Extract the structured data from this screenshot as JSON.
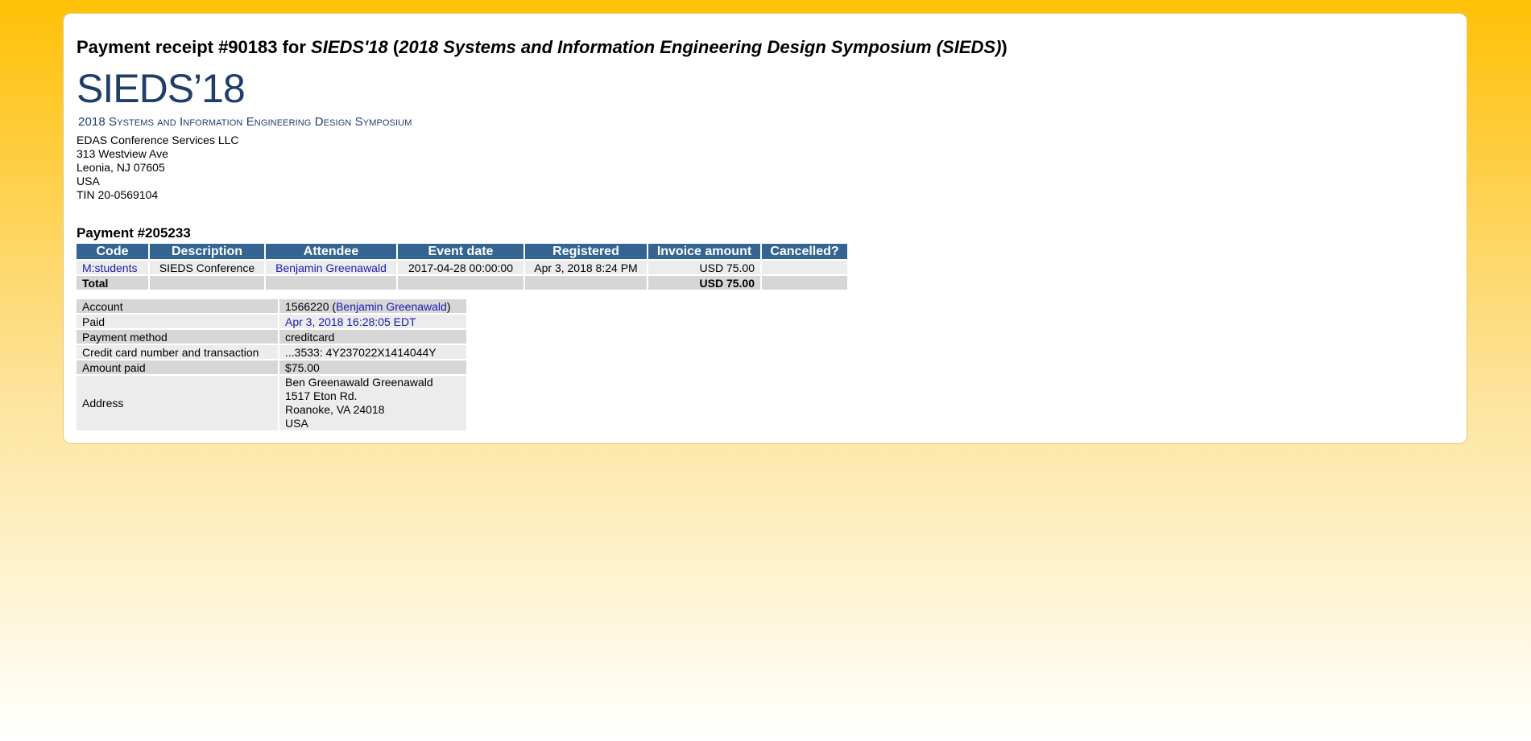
{
  "header": {
    "title_prefix": "Payment receipt #90183 for ",
    "title_short": "SIEDS'18",
    "title_paren_open": " (",
    "title_full": "2018 Systems and Information Engineering Design Symposium (SIEDS)",
    "title_paren_close": ")"
  },
  "logo": {
    "line1": "SIEDS’18",
    "line2": "2018 Systems and Information Engineering Design Symposium"
  },
  "org": {
    "name": "EDAS Conference Services LLC",
    "street": "313 Westview Ave",
    "city": "Leonia, NJ 07605",
    "country": "USA",
    "tin": "TIN 20-0569104"
  },
  "payment_title": "Payment #205233",
  "items_table": {
    "headers": [
      "Code",
      "Description",
      "Attendee",
      "Event date",
      "Registered",
      "Invoice amount",
      "Cancelled?"
    ],
    "row": {
      "code": "M:students",
      "description": "SIEDS Conference",
      "attendee": "Benjamin Greenawald",
      "event_date": "2017-04-28 00:00:00",
      "registered": "Apr 3, 2018 8:24 PM",
      "invoice_amount": "USD 75.00",
      "cancelled": ""
    },
    "total": {
      "label": "Total",
      "amount": "USD 75.00"
    }
  },
  "details": {
    "account_label": "Account",
    "account_id": "1566220",
    "account_open": " (",
    "account_name": "Benjamin Greenawald",
    "account_close": ")",
    "paid_label": "Paid",
    "paid_value": "Apr 3, 2018 16:28:05 EDT",
    "method_label": "Payment method",
    "method_value": "creditcard",
    "card_label": "Credit card number and transaction",
    "card_value": "...3533: 4Y237022X1414044Y",
    "amount_label": "Amount paid",
    "amount_value": "$75.00",
    "address_label": "Address",
    "address_lines": [
      "Ben Greenawald Greenawald",
      "1517 Eton Rd.",
      "Roanoke, VA 24018",
      "USA"
    ]
  },
  "colors": {
    "header_bg": "#346491",
    "link": "#1a1ab0",
    "page_bg_top": "#ffc107"
  }
}
